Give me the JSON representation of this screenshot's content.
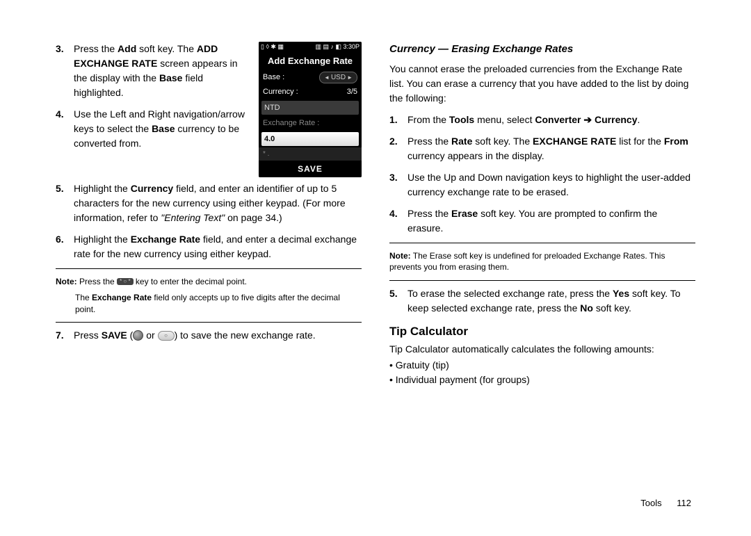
{
  "left": {
    "steps_a": [
      {
        "num": "3.",
        "html": "Press the <b>Add</b> soft key. The <b>ADD EXCHANGE RATE</b> screen appears in the display with the <b>Base</b> field highlighted."
      },
      {
        "num": "4.",
        "html": "Use the Left and Right navigation/arrow keys to select the <b>Base</b> currency to be converted from."
      },
      {
        "num": "5.",
        "html": "Highlight the <b>Currency</b> field, and enter an identifier of up to 5 characters for the new currency using either keypad. (For more information, refer to <i>\"Entering Text\"</i> on page 34.)"
      },
      {
        "num": "6.",
        "html": "Highlight the <b>Exchange Rate</b> field, and enter a decimal exchange rate for the new currency using either keypad."
      }
    ],
    "note1_prefix": "Note:",
    "note1_line1": "Press the",
    "note1_line1b": "key to enter the decimal point.",
    "note1_line2": "The <b>Exchange Rate</b> field only accepts up to five digits after the decimal point.",
    "step7_num": "7.",
    "step7_a": "Press <b>SAVE</b> (",
    "step7_or": " or ",
    "step7_b": ") to save the new exchange rate."
  },
  "screenshot": {
    "status_left": "▯ ◊ ✱ ▦",
    "status_right": "▥ ▤ ♪ ◧  3:30P",
    "title": "Add Exchange Rate",
    "row_base_label": "Base :",
    "row_base_value": "USD",
    "row_currency_label": "Currency :",
    "row_currency_value": "3/5",
    "currency_box": "NTD",
    "exchange_label": "Exchange Rate :",
    "exchange_value": "4.0",
    "bottom_row": "*  .",
    "save": "SAVE"
  },
  "right": {
    "subheading": "Currency — Erasing Exchange Rates",
    "intro": "You cannot erase the preloaded currencies from the Exchange Rate list. You can erase a currency that you have added to the list by doing the following:",
    "steps": [
      {
        "num": "1.",
        "html": "From the <b>Tools</b> menu, select <b>Converter <span class=\"arrow\">➔</span> Currency</b>."
      },
      {
        "num": "2.",
        "html": "Press the <b>Rate</b> soft key. The <b>EXCHANGE RATE</b> list for the <b>From</b> currency appears in the display."
      },
      {
        "num": "3.",
        "html": "Use the Up and Down navigation keys to highlight the user-added currency exchange rate to be erased."
      },
      {
        "num": "4.",
        "html": "Press the <b>Erase</b> soft key. You are prompted to confirm the erasure."
      }
    ],
    "note_prefix": "Note:",
    "note_text": "The Erase soft key is undefined for preloaded Exchange Rates. This prevents you from erasing them.",
    "step5": {
      "num": "5.",
      "html": "To erase the selected exchange rate, press the <b>Yes</b> soft key. To keep selected exchange rate, press the <b>No</b> soft key."
    },
    "section_heading": "Tip Calculator",
    "tip_intro": "Tip Calculator automatically calculates the following amounts:",
    "bullets": [
      "Gratuity (tip)",
      "Individual payment (for groups)"
    ]
  },
  "footer": {
    "section": "Tools",
    "page": "112"
  }
}
